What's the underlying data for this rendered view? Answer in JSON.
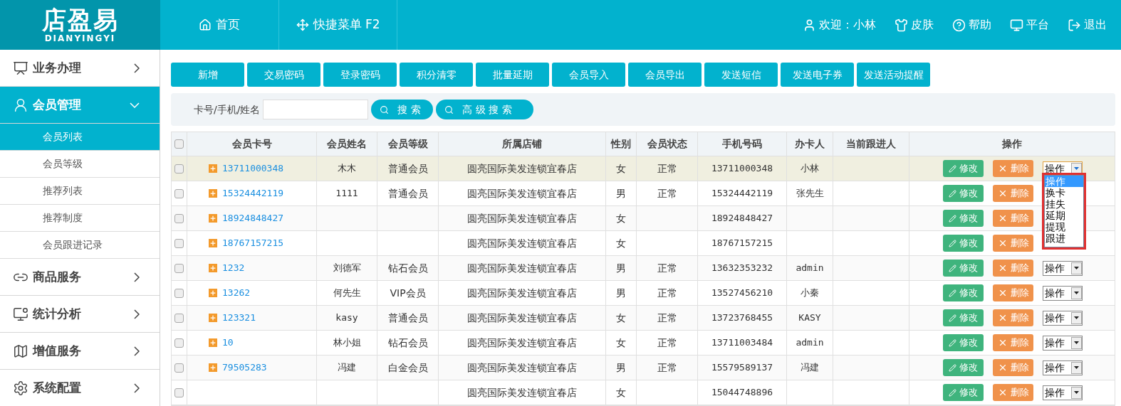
{
  "logo": {
    "title": "店盈易",
    "subtitle": "DIANYINGYI"
  },
  "top_nav": [
    {
      "label": "首页",
      "kind": "home"
    },
    {
      "label": "快捷菜单 F2",
      "kind": "move"
    }
  ],
  "user_menu": [
    {
      "label": "欢迎：小林",
      "kind": "user"
    },
    {
      "label": "皮肤",
      "kind": "shirt"
    },
    {
      "label": "帮助",
      "kind": "help"
    },
    {
      "label": "平台",
      "kind": "monitor"
    },
    {
      "label": "退出",
      "kind": "logout"
    }
  ],
  "sidebar": {
    "items": [
      {
        "label": "业务办理",
        "kind": "chart",
        "expanded": false
      },
      {
        "label": "会员管理",
        "kind": "member",
        "expanded": true,
        "children": [
          {
            "label": "会员列表",
            "selected": true
          },
          {
            "label": "会员等级",
            "selected": false
          },
          {
            "label": "推荐列表",
            "selected": false
          },
          {
            "label": "推荐制度",
            "selected": false
          },
          {
            "label": "会员跟进记录",
            "selected": false
          }
        ]
      },
      {
        "label": "商品服务",
        "kind": "link",
        "expanded": false
      },
      {
        "label": "统计分析",
        "kind": "stats",
        "expanded": false
      },
      {
        "label": "增值服务",
        "kind": "map",
        "expanded": false
      },
      {
        "label": "系统配置",
        "kind": "gear",
        "expanded": false
      }
    ]
  },
  "toolbar": [
    "新增",
    "交易密码",
    "登录密码",
    "积分清零",
    "批量延期",
    "会员导入",
    "会员导出",
    "发送短信",
    "发送电子券",
    "发送活动提醒"
  ],
  "search": {
    "label": "卡号/手机/姓名",
    "buttons": [
      "搜 索",
      "高 级 搜 索"
    ]
  },
  "table": {
    "columns": [
      "会员卡号",
      "会员姓名",
      "会员等级",
      "所属店铺",
      "性别",
      "会员状态",
      "手机号码",
      "办卡人",
      "当前跟进人",
      "操作"
    ],
    "select_all_checked": false,
    "rows": [
      {
        "selected": true,
        "checked": false,
        "card": "13711000348",
        "name": "木木",
        "level": "普通会员",
        "store": "圆亮国际美发连锁宜春店",
        "gender": "女",
        "status": "正常",
        "phone": "13711000348",
        "handler": "小林",
        "edit_label": "修改",
        "delete_label": "删除",
        "select_label": "操作",
        "expanded": true,
        "options": [
          {
            "label": "操作",
            "selected": true
          },
          {
            "label": "换卡",
            "selected": false
          },
          {
            "label": "挂失",
            "selected": false
          },
          {
            "label": "延期",
            "selected": false
          },
          {
            "label": "提现",
            "selected": false
          },
          {
            "label": "跟进",
            "selected": false
          }
        ]
      },
      {
        "selected": false,
        "checked": false,
        "card": "15324442119",
        "name": "1111",
        "level": "普通会员",
        "store": "圆亮国际美发连锁宜春店",
        "gender": "男",
        "status": "正常",
        "phone": "15324442119",
        "handler": "张先生",
        "edit_label": "修改",
        "delete_label": "删除"
      },
      {
        "selected": false,
        "checked": false,
        "card": "18924848427",
        "store": "圆亮国际美发连锁宜春店",
        "gender": "女",
        "phone": "18924848427",
        "edit_label": "修改",
        "delete_label": "删除"
      },
      {
        "selected": false,
        "checked": false,
        "card": "18767157215",
        "store": "圆亮国际美发连锁宜春店",
        "gender": "女",
        "phone": "18767157215",
        "edit_label": "修改",
        "delete_label": "删除"
      },
      {
        "selected": false,
        "checked": false,
        "card": "1232",
        "name": "刘德军",
        "level": "钻石会员",
        "store": "圆亮国际美发连锁宜春店",
        "gender": "男",
        "status": "正常",
        "phone": "13632353232",
        "handler": "admin",
        "edit_label": "修改",
        "delete_label": "删除",
        "select_label": "操作",
        "expanded": false
      },
      {
        "selected": false,
        "checked": false,
        "card": "13262",
        "name": "何先生",
        "level": "VIP会员",
        "store": "圆亮国际美发连锁宜春店",
        "gender": "男",
        "status": "正常",
        "phone": "13527456210",
        "handler": "小秦",
        "edit_label": "修改",
        "delete_label": "删除",
        "select_label": "操作",
        "expanded": false
      },
      {
        "selected": false,
        "checked": false,
        "card": "123321",
        "name": "kasy",
        "level": "普通会员",
        "store": "圆亮国际美发连锁宜春店",
        "gender": "女",
        "status": "正常",
        "phone": "13723768455",
        "handler": "KASY",
        "edit_label": "修改",
        "delete_label": "删除",
        "select_label": "操作",
        "expanded": false
      },
      {
        "selected": false,
        "checked": false,
        "card": "10",
        "name": "林小姐",
        "level": "钻石会员",
        "store": "圆亮国际美发连锁宜春店",
        "gender": "女",
        "status": "正常",
        "phone": "13711003484",
        "handler": "admin",
        "edit_label": "修改",
        "delete_label": "删除",
        "select_label": "操作",
        "expanded": false
      },
      {
        "selected": false,
        "checked": false,
        "card": "79505283",
        "name": "冯建",
        "level": "白金会员",
        "store": "圆亮国际美发连锁宜春店",
        "gender": "男",
        "status": "正常",
        "phone": "15579589137",
        "handler": "冯建",
        "edit_label": "修改",
        "delete_label": "删除",
        "select_label": "操作",
        "expanded": false
      },
      {
        "selected": false,
        "checked": false,
        "store": "圆亮国际美发连锁宜春店",
        "gender": "女",
        "phone": "15044748896",
        "edit_label": "修改",
        "delete_label": "删除",
        "select_label": "操作",
        "expanded": false
      }
    ]
  }
}
